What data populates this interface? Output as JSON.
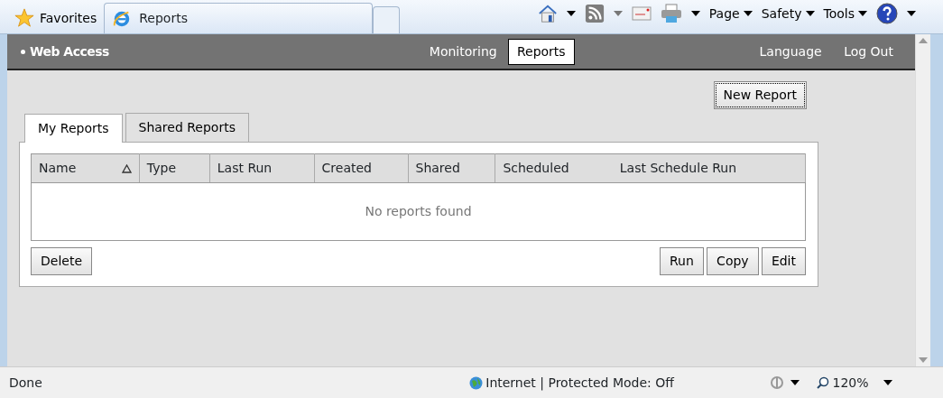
{
  "browser": {
    "favorites": "Favorites",
    "tabs": [
      {
        "label": "Reports",
        "selected": true
      }
    ],
    "commands": [
      "Page",
      "Safety",
      "Tools"
    ]
  },
  "app": {
    "brand": "Web Access",
    "nav": [
      {
        "label": "Monitoring",
        "selected": false
      },
      {
        "label": "Reports",
        "selected": true
      }
    ],
    "links": [
      "Language",
      "Log Out"
    ]
  },
  "new_report": "New Report",
  "report_tabs": [
    {
      "label": "My Reports",
      "selected": true
    },
    {
      "label": "Shared Reports",
      "selected": false
    }
  ],
  "table": {
    "columns": [
      {
        "label": "Name",
        "sorted": true
      },
      {
        "label": "Type",
        "sorted": false
      },
      {
        "label": "Last Run",
        "sorted": false
      },
      {
        "label": "Created",
        "sorted": false
      },
      {
        "label": "Shared",
        "sorted": false
      },
      {
        "label": "Scheduled",
        "sorted": false
      },
      {
        "label": "Last Schedule Run",
        "sorted": false
      }
    ],
    "empty_message": "No reports found"
  },
  "left_actions": [
    "Delete"
  ],
  "right_actions": [
    "Run",
    "Copy",
    "Edit"
  ],
  "status_bar": {
    "text": "Done",
    "zone": "Internet | Protected Mode: Off",
    "zoom": "120%"
  }
}
